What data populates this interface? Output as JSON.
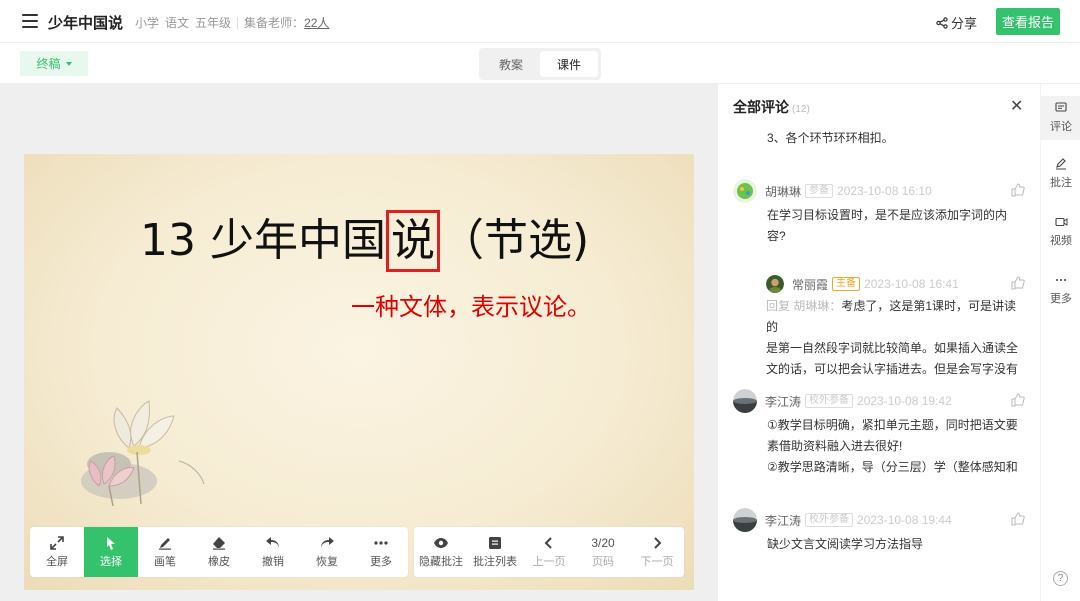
{
  "header": {
    "title": "少年中国说",
    "stage": "小学",
    "subject": "语文",
    "grade": "五年级",
    "teachers_label": "集备老师：",
    "teachers_value": "22人",
    "share_label": "分享",
    "report_button": "查看报告"
  },
  "subbar": {
    "status": "终稿",
    "tabs": [
      {
        "label": "教案",
        "active": false
      },
      {
        "label": "课件",
        "active": true
      }
    ]
  },
  "slide": {
    "title_prefix": "13 少年中国",
    "title_boxed": "说",
    "title_suffix": "（节选)",
    "note": "一种文体，表示议论。"
  },
  "toolbar": {
    "fullscreen": "全屏",
    "select": "选择",
    "pen": "画笔",
    "eraser": "橡皮",
    "undo": "撤销",
    "redo": "恢复",
    "more": "更多",
    "hide_annot": "隐藏批注",
    "annot_list": "批注列表",
    "prev": "上一页",
    "page": "3/20",
    "page_label": "页码",
    "next": "下一页"
  },
  "comments_panel": {
    "title": "全部评论",
    "count": "(12)",
    "top_text": "3、各个环节环环相扣。",
    "comments": [
      {
        "name": "胡琳琳",
        "badge": "参备",
        "time": "2023-10-08 16:10",
        "lines": [
          "在学习目标设置时，是不是应该添加字词的内",
          "容?"
        ]
      },
      {
        "name": "常丽霞",
        "badge": "主备",
        "time": "2023-10-08 16:41",
        "reply_prefix": "回复 胡琳琳：",
        "lines": [
          "考虑了，这是第1课时，可是讲读的",
          "是第一自然段字词就比较简单。如果插入通读全",
          "文的话，可以把会认字插进去。但是会写字没有"
        ]
      },
      {
        "name": "李江涛",
        "badge": "校外参备",
        "time": "2023-10-08 19:42",
        "lines": [
          "①教学目标明确，紧扣单元主题，同时把语文要",
          "素借助资料融入进去很好!",
          "②教学思路清晰，导（分三层）学（整体感知和"
        ]
      },
      {
        "name": "李江涛",
        "badge": "校外参备",
        "time": "2023-10-08 19:44",
        "lines": [
          "缺少文言文阅读学习方法指导"
        ]
      }
    ]
  },
  "rail": {
    "comment": "评论",
    "annotate": "批注",
    "video": "视频",
    "more": "更多",
    "help": "?"
  },
  "colors": {
    "accent": "#35c26d",
    "highlight_red": "#e02020",
    "badge_orange": "#f5a623"
  },
  "icons": [
    "menu-icon",
    "share-icon",
    "fullscreen-icon",
    "cursor-icon",
    "pen-icon",
    "eraser-icon",
    "undo-icon",
    "redo-icon",
    "more-dots-icon",
    "eye-icon",
    "list-icon",
    "chevron-left-icon",
    "chevron-right-icon",
    "close-icon",
    "like-icon",
    "comment-icon",
    "edit-icon",
    "video-icon",
    "help-icon"
  ]
}
